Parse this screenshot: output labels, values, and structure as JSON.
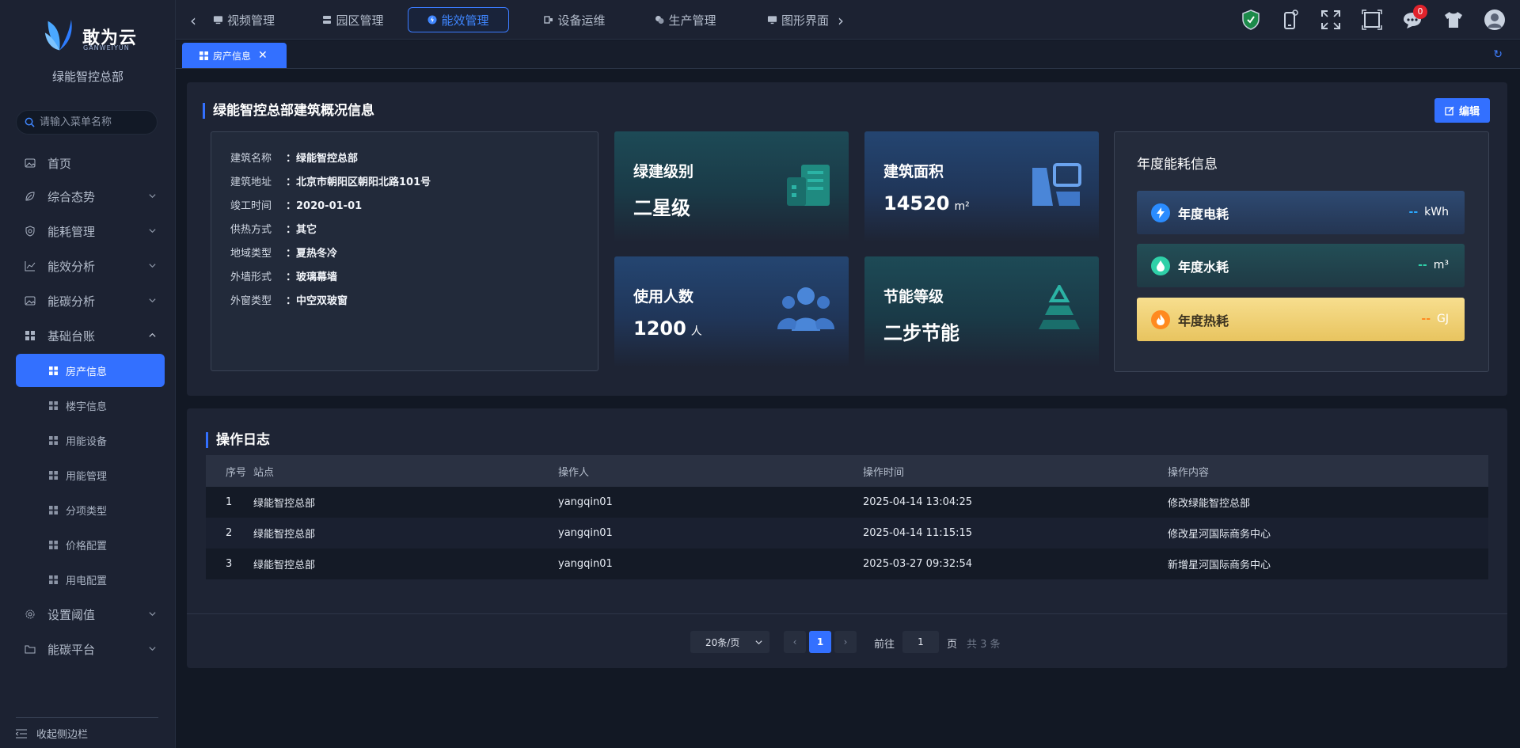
{
  "sidebar": {
    "logo_text": "敢为云",
    "logo_sub": "GANWEIYUN",
    "org_name": "绿能智控总部",
    "search_placeholder": "请输入菜单名称",
    "menu": [
      {
        "label": "首页",
        "icon": "image-icon"
      },
      {
        "label": "综合态势",
        "icon": "leaf-icon"
      },
      {
        "label": "能耗管理",
        "icon": "shield-icon"
      },
      {
        "label": "能效分析",
        "icon": "line-chart-icon"
      },
      {
        "label": "能碳分析",
        "icon": "image-icon"
      },
      {
        "label": "基础台账",
        "icon": "grid-icon"
      }
    ],
    "submenu": [
      {
        "label": "房产信息"
      },
      {
        "label": "楼宇信息"
      },
      {
        "label": "用能设备"
      },
      {
        "label": "用能管理"
      },
      {
        "label": "分项类型"
      },
      {
        "label": "价格配置"
      },
      {
        "label": "用电配置"
      }
    ],
    "menu_bottom": [
      {
        "label": "设置阈值",
        "icon": "gear-icon"
      },
      {
        "label": "能碳平台",
        "icon": "folder-icon"
      }
    ],
    "collapse_label": "收起侧边栏"
  },
  "topnav": {
    "tabs": [
      {
        "label": "视频管理",
        "icon": "monitor-icon"
      },
      {
        "label": "园区管理",
        "icon": "database-icon"
      },
      {
        "label": "能效管理",
        "icon": "energy-icon"
      },
      {
        "label": "设备运维",
        "icon": "device-icon"
      },
      {
        "label": "生产管理",
        "icon": "chat-icon"
      },
      {
        "label": "图形界面",
        "icon": "screen-icon"
      }
    ],
    "notification_count": "0"
  },
  "page_tab": {
    "label": "房产信息"
  },
  "overview": {
    "title": "绿能智控总部建筑概况信息",
    "edit_label": "编辑",
    "info": [
      {
        "key": "建筑名称",
        "value": "：绿能智控总部"
      },
      {
        "key": "建筑地址",
        "value": "：北京市朝阳区朝阳北路101号"
      },
      {
        "key": "竣工时间",
        "value": "：2020-01-01"
      },
      {
        "key": "供热方式",
        "value": "：其它"
      },
      {
        "key": "地域类型",
        "value": "：夏热冬冷"
      },
      {
        "key": "外墙形式",
        "value": "：玻璃幕墙"
      },
      {
        "key": "外窗类型",
        "value": "：中空双玻窗"
      }
    ],
    "stats": [
      {
        "label": "绿建级别",
        "value": "二星级",
        "unit": ""
      },
      {
        "label": "建筑面积",
        "value": "14520",
        "unit": "m²"
      },
      {
        "label": "使用人数",
        "value": "1200",
        "unit": "人"
      },
      {
        "label": "节能等级",
        "value": "二步节能",
        "unit": ""
      }
    ],
    "energy_title": "年度能耗信息",
    "energy": [
      {
        "label": "年度电耗",
        "value": "--",
        "unit": "kWh",
        "color": "#2a8cff"
      },
      {
        "label": "年度水耗",
        "value": "--",
        "unit": "m³",
        "color": "#2fd0a8"
      },
      {
        "label": "年度热耗",
        "value": "--",
        "unit": "GJ",
        "color": "#ff8a1f"
      }
    ]
  },
  "log": {
    "title": "操作日志",
    "columns": [
      "序号",
      "站点",
      "操作人",
      "操作时间",
      "操作内容"
    ],
    "rows": [
      [
        "1",
        "绿能智控总部",
        "yangqin01",
        "2025-04-14 13:04:25",
        "修改绿能智控总部"
      ],
      [
        "2",
        "绿能智控总部",
        "yangqin01",
        "2025-04-14 11:15:15",
        "修改星河国际商务中心"
      ],
      [
        "3",
        "绿能智控总部",
        "yangqin01",
        "2025-03-27 09:32:54",
        "新增星河国际商务中心"
      ]
    ]
  },
  "pager": {
    "page_size": "20条/页",
    "current_page": "1",
    "goto_label": "前往",
    "goto_value": "1",
    "page_unit": "页",
    "total": "共 3 条"
  },
  "colors": {
    "accent": "#3370ff",
    "bg": "#121824",
    "panel": "#1e2434"
  }
}
